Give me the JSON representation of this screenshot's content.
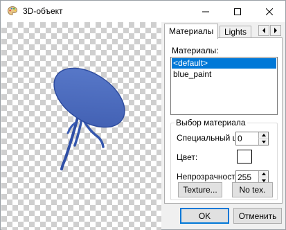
{
  "window": {
    "title": "3D-объект"
  },
  "tabs": [
    {
      "label": "Материалы",
      "active": true
    },
    {
      "label": "Lights",
      "active": false
    }
  ],
  "materials": {
    "label": "Материалы:",
    "items": [
      {
        "label": "<default>",
        "selected": true
      },
      {
        "label": "blue_paint",
        "selected": false
      }
    ]
  },
  "material_group": {
    "title": "Выбор материала",
    "special": {
      "label": "Специальный цвет",
      "value": "0"
    },
    "color": {
      "label": "Цвет:",
      "value_hex": "#ffffff"
    },
    "opacity": {
      "label": "Непрозрачность",
      "value": "255"
    },
    "texture_button": "Texture...",
    "no_texture_button": "No tex."
  },
  "footer": {
    "ok_label": "OK",
    "cancel_label": "Отменить"
  },
  "colors": {
    "accent": "#0078d7",
    "object": "#4a6bc0"
  }
}
